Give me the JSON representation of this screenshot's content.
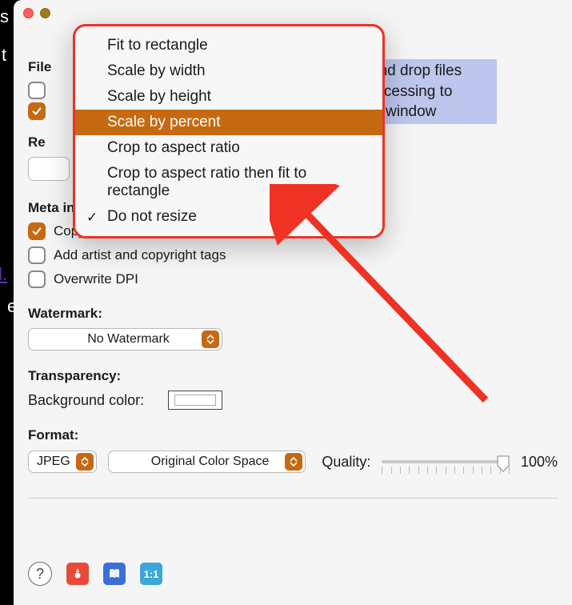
{
  "sidebar_fragment": {
    "l1": "l.",
    "l2": "e",
    "t": "t",
    "s": "s"
  },
  "hint": {
    "line1": "and drop files",
    "line2": "rocessing to",
    "line3": "is window"
  },
  "sections": {
    "file_label": "File",
    "resize_label_fragment": "Re",
    "meta_label": "Meta information:",
    "watermark_label": "Watermark:",
    "transparency_label": "Transparency:",
    "background_color_label": "Background color:",
    "format_label": "Format:"
  },
  "checkboxes": {
    "cb1_checked": false,
    "cb2_checked": true,
    "copy_metadata_checked": true,
    "copy_metadata_label": "Copy metadata",
    "artist_checked": false,
    "artist_label": "Add artist and copyright tags",
    "dpi_checked": false,
    "dpi_label": "Overwrite DPI"
  },
  "dropdowns": {
    "watermark_value": "No Watermark",
    "format_value": "JPEG",
    "colorspace_value": "Original Color Space"
  },
  "quality": {
    "label": "Quality:",
    "value_text": "100%",
    "value": 100
  },
  "resize_menu": {
    "items": [
      {
        "label": "Fit to rectangle"
      },
      {
        "label": "Scale by width"
      },
      {
        "label": "Scale by height"
      },
      {
        "label": "Scale by percent",
        "highlighted": true
      },
      {
        "label": "Crop to aspect ratio"
      },
      {
        "label": "Crop to aspect ratio then fit to rectangle"
      },
      {
        "label": "Do not resize",
        "checked": true
      }
    ]
  },
  "footer_icons": {
    "help": "?",
    "icon1_label": "flower-icon",
    "icon2_label": "book-icon",
    "icon3_label": "ratio-icon",
    "icon3_text": "1:1"
  },
  "annotation": {
    "arrow_color": "#ee3224"
  }
}
